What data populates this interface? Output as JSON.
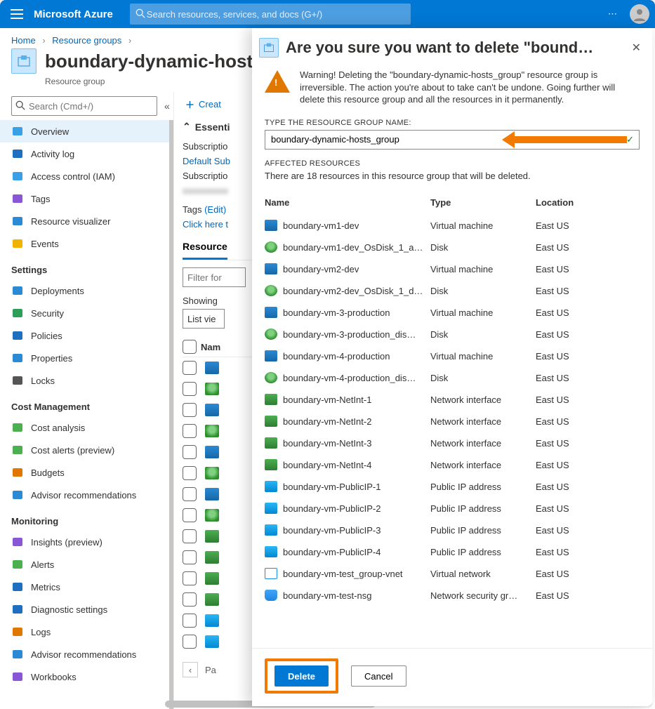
{
  "brand": "Microsoft Azure",
  "search_placeholder": "Search resources, services, and docs (G+/)",
  "breadcrumb": {
    "home": "Home",
    "rg": "Resource groups"
  },
  "page": {
    "title": "boundary-dynamic-hosts_g",
    "subtitle": "Resource group"
  },
  "left_filter_placeholder": "Search (Cmd+/)",
  "nav_primary": [
    {
      "label": "Overview",
      "icon": "cube"
    },
    {
      "label": "Activity log",
      "icon": "log"
    },
    {
      "label": "Access control (IAM)",
      "icon": "iam"
    },
    {
      "label": "Tags",
      "icon": "tag"
    },
    {
      "label": "Resource visualizer",
      "icon": "vis"
    },
    {
      "label": "Events",
      "icon": "bolt"
    }
  ],
  "nav_groups": [
    {
      "title": "Settings",
      "items": [
        {
          "label": "Deployments",
          "icon": "deploy"
        },
        {
          "label": "Security",
          "icon": "shield"
        },
        {
          "label": "Policies",
          "icon": "policy"
        },
        {
          "label": "Properties",
          "icon": "props"
        },
        {
          "label": "Locks",
          "icon": "lock"
        }
      ]
    },
    {
      "title": "Cost Management",
      "items": [
        {
          "label": "Cost analysis",
          "icon": "cost"
        },
        {
          "label": "Cost alerts (preview)",
          "icon": "alert"
        },
        {
          "label": "Budgets",
          "icon": "budget"
        },
        {
          "label": "Advisor recommendations",
          "icon": "advisor"
        }
      ]
    },
    {
      "title": "Monitoring",
      "items": [
        {
          "label": "Insights (preview)",
          "icon": "insight"
        },
        {
          "label": "Alerts",
          "icon": "alerts"
        },
        {
          "label": "Metrics",
          "icon": "metrics"
        },
        {
          "label": "Diagnostic settings",
          "icon": "diag"
        },
        {
          "label": "Logs",
          "icon": "logs"
        },
        {
          "label": "Advisor recommendations",
          "icon": "advisor"
        },
        {
          "label": "Workbooks",
          "icon": "workbook"
        }
      ]
    }
  ],
  "mid": {
    "create": "Creat",
    "essentials": "Essenti",
    "sub_label": "Subscriptio",
    "sub_value": "Default Sub",
    "subid_label": "Subscriptio",
    "tags_label": "Tags",
    "tags_edit": "(Edit)",
    "tags_link": "Click here t",
    "tab_resources": "Resource",
    "filter_placeholder": "Filter for",
    "showing": "Showing",
    "listmode": "List vie",
    "col_name": "Nam",
    "row_icons": [
      "vm",
      "disk",
      "vm",
      "disk",
      "vm",
      "disk",
      "vm",
      "disk",
      "net",
      "net",
      "net",
      "net",
      "ip",
      "ip"
    ],
    "page_label": "Pa"
  },
  "blade": {
    "title": "Are you sure you want to delete \"bound…",
    "warning": "Warning! Deleting the \"boundary-dynamic-hosts_group\" resource group is irreversible. The action you're about to take can't be undone. Going further will delete this resource group and all the resources in it permanently.",
    "type_label": "TYPE THE RESOURCE GROUP NAME:",
    "input_value": "boundary-dynamic-hosts_group",
    "affected_label": "AFFECTED RESOURCES",
    "affected_note": "There are 18 resources in this resource group that will be deleted.",
    "cols": {
      "name": "Name",
      "type": "Type",
      "loc": "Location"
    },
    "resources": [
      {
        "name": "boundary-vm1-dev",
        "type": "Virtual machine",
        "loc": "East US",
        "icon": "vm"
      },
      {
        "name": "boundary-vm1-dev_OsDisk_1_a…",
        "type": "Disk",
        "loc": "East US",
        "icon": "disk"
      },
      {
        "name": "boundary-vm2-dev",
        "type": "Virtual machine",
        "loc": "East US",
        "icon": "vm"
      },
      {
        "name": "boundary-vm2-dev_OsDisk_1_d…",
        "type": "Disk",
        "loc": "East US",
        "icon": "disk"
      },
      {
        "name": "boundary-vm-3-production",
        "type": "Virtual machine",
        "loc": "East US",
        "icon": "vm"
      },
      {
        "name": "boundary-vm-3-production_dis…",
        "type": "Disk",
        "loc": "East US",
        "icon": "disk"
      },
      {
        "name": "boundary-vm-4-production",
        "type": "Virtual machine",
        "loc": "East US",
        "icon": "vm"
      },
      {
        "name": "boundary-vm-4-production_dis…",
        "type": "Disk",
        "loc": "East US",
        "icon": "disk"
      },
      {
        "name": "boundary-vm-NetInt-1",
        "type": "Network interface",
        "loc": "East US",
        "icon": "net"
      },
      {
        "name": "boundary-vm-NetInt-2",
        "type": "Network interface",
        "loc": "East US",
        "icon": "net"
      },
      {
        "name": "boundary-vm-NetInt-3",
        "type": "Network interface",
        "loc": "East US",
        "icon": "net"
      },
      {
        "name": "boundary-vm-NetInt-4",
        "type": "Network interface",
        "loc": "East US",
        "icon": "net"
      },
      {
        "name": "boundary-vm-PublicIP-1",
        "type": "Public IP address",
        "loc": "East US",
        "icon": "ip"
      },
      {
        "name": "boundary-vm-PublicIP-2",
        "type": "Public IP address",
        "loc": "East US",
        "icon": "ip"
      },
      {
        "name": "boundary-vm-PublicIP-3",
        "type": "Public IP address",
        "loc": "East US",
        "icon": "ip"
      },
      {
        "name": "boundary-vm-PublicIP-4",
        "type": "Public IP address",
        "loc": "East US",
        "icon": "ip"
      },
      {
        "name": "boundary-vm-test_group-vnet",
        "type": "Virtual network",
        "loc": "East US",
        "icon": "vnet"
      },
      {
        "name": "boundary-vm-test-nsg",
        "type": "Network security gr…",
        "loc": "East US",
        "icon": "nsg"
      }
    ],
    "delete": "Delete",
    "cancel": "Cancel"
  },
  "nav_colors": {
    "cube": "#3aa0e6",
    "log": "#1e6fc0",
    "iam": "#3aa0e6",
    "tag": "#8956d6",
    "vis": "#2a8ad4",
    "bolt": "#f2b200",
    "deploy": "#2a8ad4",
    "shield": "#2e9e5b",
    "policy": "#1e6fc0",
    "props": "#2a8ad4",
    "lock": "#555",
    "cost": "#4caf50",
    "alert": "#4caf50",
    "budget": "#e07800",
    "advisor": "#2a8ad4",
    "insight": "#8956d6",
    "alerts": "#4caf50",
    "metrics": "#1e6fc0",
    "diag": "#1e6fc0",
    "logs": "#e07800",
    "workbook": "#8956d6"
  }
}
